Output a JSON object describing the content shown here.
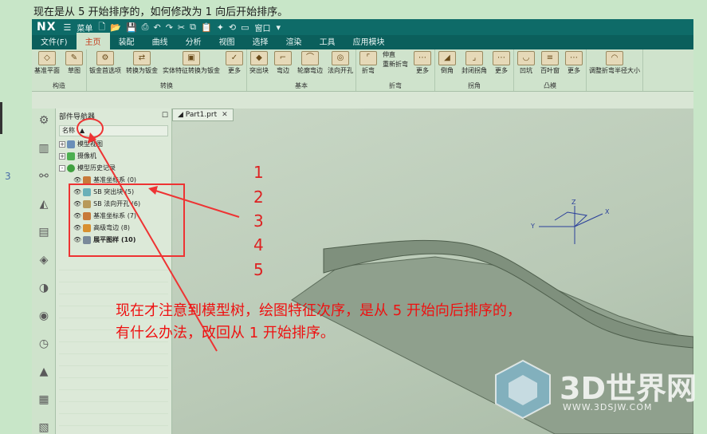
{
  "question": "现在是从 5 开始排序的，如何修改为 1 向后开始排序。",
  "left_edge": {
    "digit": "3"
  },
  "app": {
    "logo": "NX",
    "quick": {
      "menu_label": "菜单",
      "window_label": "窗口"
    },
    "menu": [
      "文件(F)",
      "主页",
      "装配",
      "曲线",
      "分析",
      "视图",
      "选择",
      "渲染",
      "工具",
      "应用模块"
    ],
    "active_menu": "主页",
    "ribbon_groups": [
      {
        "label": "构造",
        "items": [
          "基准平面",
          "草图"
        ]
      },
      {
        "label": "转换",
        "items": [
          "钣金首选项",
          "转换为钣金",
          "实体特征转换为钣金",
          "更多"
        ]
      },
      {
        "label": "基本",
        "items": [
          "突出块",
          "弯边",
          "轮廓弯边",
          "法向开孔"
        ]
      },
      {
        "label": "折弯",
        "items": [
          "折弯",
          "伸直",
          "重新折弯",
          "更多"
        ]
      },
      {
        "label": "拐角",
        "items": [
          "倒角",
          "封闭拐角",
          "更多"
        ]
      },
      {
        "label": "凸模",
        "items": [
          "凹坑",
          "百叶窗",
          "更多"
        ]
      },
      {
        "label": "",
        "items": [
          "调整折弯半径大小"
        ]
      }
    ],
    "navigator": {
      "title": "部件导航器",
      "column": "名称",
      "nodes": [
        {
          "label": "模型视图",
          "expander": "+",
          "eye": ""
        },
        {
          "label": "摄像机",
          "expander": "+",
          "eye": ""
        },
        {
          "label": "模型历史记录",
          "expander": "-",
          "eye": ""
        },
        {
          "label": "基准坐标系 (0)",
          "expander": "",
          "eye": "👁"
        },
        {
          "label": "SB 突出块 (5)",
          "expander": "",
          "eye": "👁"
        },
        {
          "label": "SB 法向开孔 (6)",
          "expander": "",
          "eye": "👁"
        },
        {
          "label": "基准坐标系 (7)",
          "expander": "",
          "eye": "👁"
        },
        {
          "label": "高级弯边 (8)",
          "expander": "",
          "eye": "👁"
        },
        {
          "label": "展平图样 (10)",
          "expander": "",
          "eye": "👁"
        }
      ]
    },
    "tab": {
      "label": "Part1.prt"
    },
    "axes": {
      "x": "X",
      "y": "Y",
      "z": "Z"
    }
  },
  "annotation": {
    "numbers": [
      "1",
      "2",
      "3",
      "4",
      "5"
    ],
    "note_line1": "现在才注意到模型树，绘图特征次序，是从 5 开始向后排序的，",
    "note_line2": "有什么办法，改回从 1 开始排序。"
  },
  "watermark": {
    "title": "3D世界网",
    "url": "WWW.3DSJW.COM"
  },
  "colors": {
    "titlebar": "#0e6b68",
    "ribbon": "#cfe3cc",
    "annotation": "#e33333"
  }
}
